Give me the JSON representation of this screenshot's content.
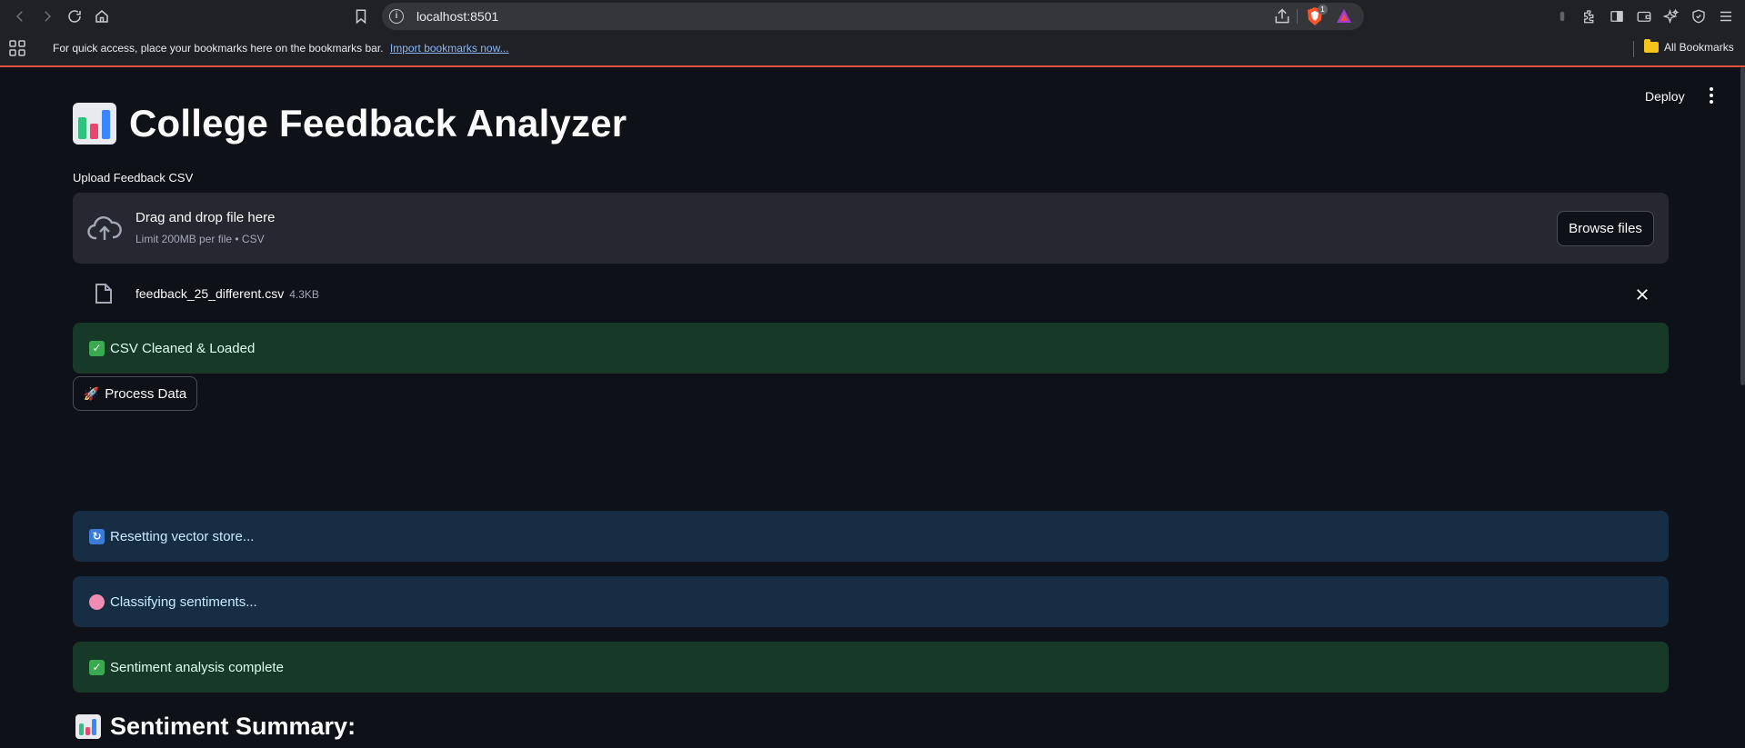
{
  "browser": {
    "url": "localhost:8501",
    "shield_count": "1",
    "bookmarks_message": "For quick access, place your bookmarks here on the bookmarks bar.",
    "import_link": "Import bookmarks now...",
    "all_bookmarks": "All Bookmarks"
  },
  "header": {
    "deploy_label": "Deploy"
  },
  "page": {
    "title": "College Feedback Analyzer",
    "title_icon": "bar-chart-emoji"
  },
  "uploader": {
    "label": "Upload Feedback CSV",
    "drag_text": "Drag and drop file here",
    "limit_text": "Limit 200MB per file • CSV",
    "browse_label": "Browse files"
  },
  "file": {
    "name": "feedback_25_different.csv",
    "size": "4.3KB"
  },
  "messages": {
    "cleaned": "CSV Cleaned & Loaded",
    "resetting": "Resetting vector store...",
    "classifying": "Classifying sentiments...",
    "complete": "Sentiment analysis complete"
  },
  "actions": {
    "process_label": "Process Data"
  },
  "section": {
    "summary_title": "Sentiment Summary:"
  },
  "colors": {
    "background": "#0e1117",
    "success_bg": "#173928",
    "info_bg": "#172d43",
    "dropzone_bg": "#262730"
  }
}
